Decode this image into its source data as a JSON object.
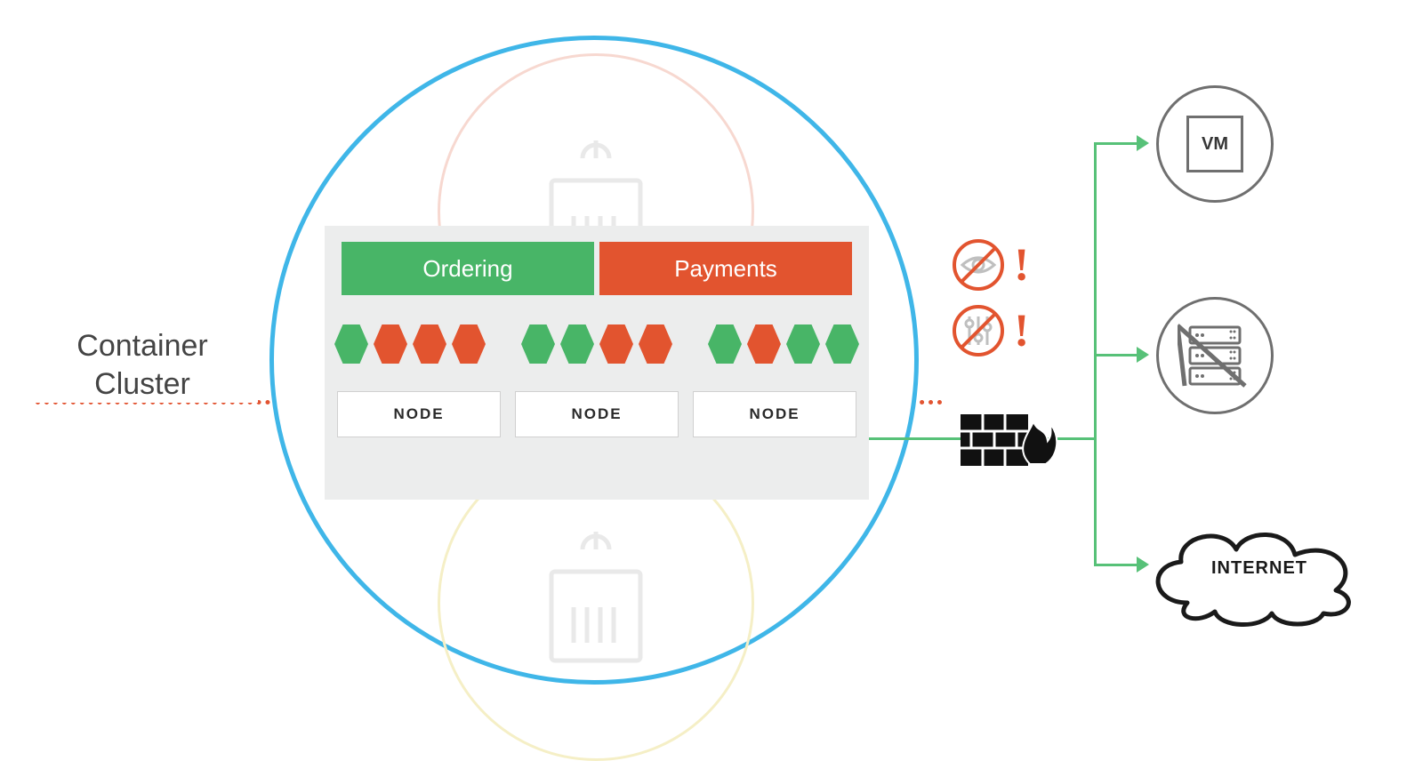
{
  "label": {
    "cluster": "Container Cluster"
  },
  "services": {
    "ordering": "Ordering",
    "payments": "Payments"
  },
  "hexagons": [
    [
      "green",
      "orange",
      "orange",
      "orange"
    ],
    [
      "green",
      "green",
      "orange",
      "orange"
    ],
    [
      "green",
      "orange",
      "green",
      "green"
    ]
  ],
  "nodes": [
    "NODE",
    "NODE",
    "NODE"
  ],
  "warnings": {
    "no_visibility_icon": "no-visibility-icon",
    "no_control_icon": "no-control-icon",
    "bang": "!"
  },
  "firewall_icon": "firewall-icon",
  "targets": {
    "vm": "VM",
    "server": "server-rack-icon",
    "internet": "INTERNET"
  },
  "colors": {
    "green": "#48b567",
    "orange": "#e2542f",
    "blue": "#3fb6e8",
    "line": "#57c178"
  }
}
